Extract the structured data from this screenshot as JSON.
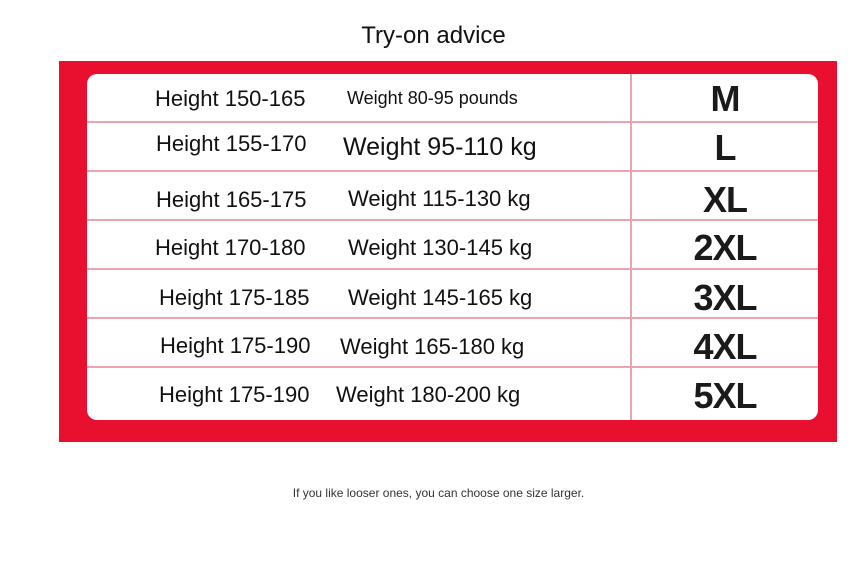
{
  "title": "Try-on advice",
  "rows": [
    {
      "height": "Height 150-165",
      "weight": "Weight 80-95 pounds",
      "size": "M"
    },
    {
      "height": "Height 155-170",
      "weight": "Weight 95-110 kg",
      "size": "L"
    },
    {
      "height": "Height 165-175",
      "weight": "Weight 115-130 kg",
      "size": "XL"
    },
    {
      "height": "Height 170-180",
      "weight": "Weight 130-145 kg",
      "size": "2XL"
    },
    {
      "height": "Height 175-185",
      "weight": "Weight 145-165 kg",
      "size": "3XL"
    },
    {
      "height": "Height 175-190",
      "weight": "Weight 165-180 kg",
      "size": "4XL"
    },
    {
      "height": "Height 175-190",
      "weight": "Weight 180-200 kg",
      "size": "5XL"
    }
  ],
  "note": "If you like looser ones, you can choose one size larger.",
  "colors": {
    "frame": "#e8102e",
    "divider": "#e9a4ad"
  }
}
